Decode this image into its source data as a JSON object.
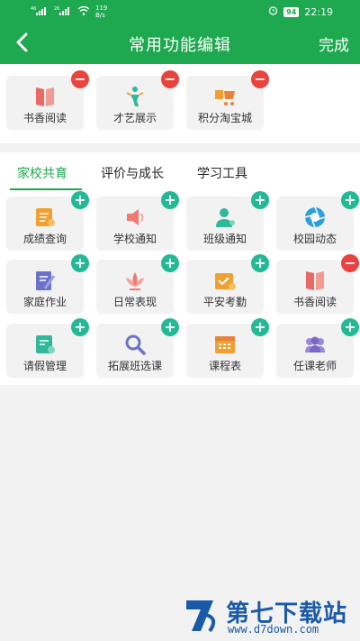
{
  "status_bar": {
    "signal_left": "46",
    "signal_right": "26",
    "net_speed": "119",
    "net_unit": "B/s",
    "battery": "94",
    "time": "22:19"
  },
  "header": {
    "title": "常用功能编辑",
    "done_label": "完成"
  },
  "favorites": [
    {
      "label": "书香阅读",
      "badge": "−"
    },
    {
      "label": "才艺展示",
      "badge": "−"
    },
    {
      "label": "积分淘宝城",
      "badge": "−"
    }
  ],
  "tabs": [
    {
      "label": "家校共育",
      "active": true
    },
    {
      "label": "评价与成长",
      "active": false
    },
    {
      "label": "学习工具",
      "active": false
    }
  ],
  "grid": [
    {
      "label": "成绩查询",
      "badge": "+"
    },
    {
      "label": "学校通知",
      "badge": "+"
    },
    {
      "label": "班级通知",
      "badge": "+"
    },
    {
      "label": "校园动态",
      "badge": "+"
    },
    {
      "label": "家庭作业",
      "badge": "+"
    },
    {
      "label": "日常表现",
      "badge": "+"
    },
    {
      "label": "平安考勤",
      "badge": "+"
    },
    {
      "label": "书香阅读",
      "badge": "−"
    },
    {
      "label": "请假管理",
      "badge": "+"
    },
    {
      "label": "拓展班选课",
      "badge": "+"
    },
    {
      "label": "课程表",
      "badge": "+"
    },
    {
      "label": "任课老师",
      "badge": "+"
    }
  ],
  "watermark": {
    "brand": "第七下载站",
    "url": "www.d7down.com"
  },
  "colors": {
    "accent": "#1ea84f",
    "minus": "#e8433f",
    "plus": "#23b995"
  }
}
